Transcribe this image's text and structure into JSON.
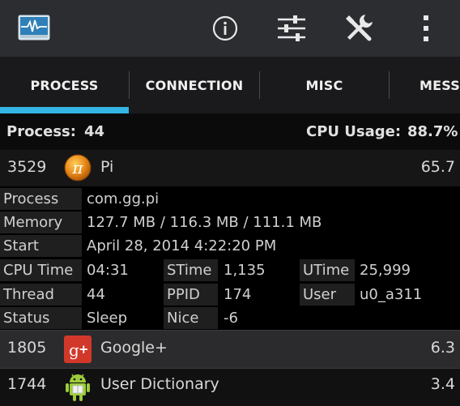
{
  "colors": {
    "accent": "#33b5e5",
    "action_bar": "#2c2d30"
  },
  "action_bar": {
    "icons": [
      "pulse-monitor-icon",
      "info-icon",
      "sliders-icon",
      "tools-icon",
      "overflow-menu-icon"
    ]
  },
  "tabs": [
    {
      "label": "PROCESS",
      "selected": true
    },
    {
      "label": "CONNECTION",
      "selected": false
    },
    {
      "label": "MISC",
      "selected": false
    },
    {
      "label": "MESS",
      "selected": false
    }
  ],
  "summary": {
    "process_label": "Process:",
    "process_count": "44",
    "cpu_label": "CPU Usage:",
    "cpu_value": "88.7%"
  },
  "processes": [
    {
      "pid": "3529",
      "name": "Pi",
      "cpu": "65.7",
      "icon": "pi-app-icon"
    },
    {
      "pid": "1805",
      "name": "Google+",
      "cpu": "6.3",
      "icon": "google-plus-icon"
    },
    {
      "pid": "1744",
      "name": "User Dictionary",
      "cpu": "3.4",
      "icon": "android-icon"
    }
  ],
  "details": {
    "process_label": "Process",
    "process_value": "com.gg.pi",
    "memory_label": "Memory",
    "memory_value": "127.7 MB /  116.3 MB / 111.1 MB",
    "start_label": "Start",
    "start_value": "April 28, 2014 4:22:20 PM",
    "cputime_label": "CPU Time",
    "cputime_value": "04:31",
    "stime_label": "STime",
    "stime_value": "1,135",
    "utime_label": "UTime",
    "utime_value": "25,999",
    "thread_label": "Thread",
    "thread_value": "44",
    "ppid_label": "PPID",
    "ppid_value": "174",
    "user_label": "User",
    "user_value": "u0_a311",
    "status_label": "Status",
    "status_value": "Sleep",
    "nice_label": "Nice",
    "nice_value": "-6"
  }
}
